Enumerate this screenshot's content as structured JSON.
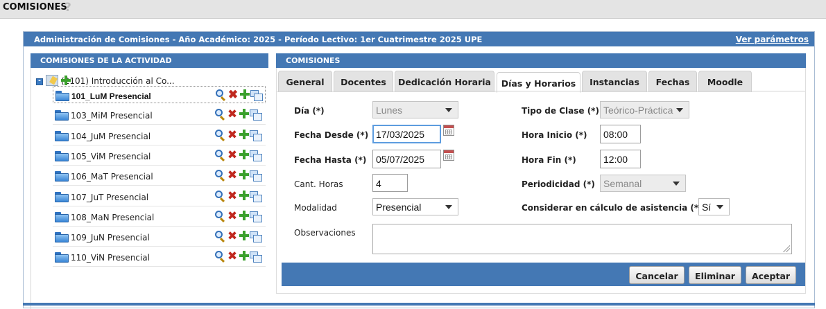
{
  "page": {
    "title": "COMISIONES",
    "help_glyph": "?"
  },
  "header": {
    "title": "Administración de Comisiones - Año Académico: 2025 - Período Lectivo: 1er Cuatrimestre 2025 UPE",
    "link": "Ver parámetros"
  },
  "left": {
    "heading": "COMISIONES DE LA ACTIVIDAD",
    "root": "(2101) Introducción al Co...",
    "items": [
      {
        "label": "101_LuM Presencial",
        "selected": true
      },
      {
        "label": "103_MiM Presencial"
      },
      {
        "label": "104_JuM Presencial"
      },
      {
        "label": "105_ViM Presencial"
      },
      {
        "label": "106_MaT Presencial"
      },
      {
        "label": "107_JuT Presencial"
      },
      {
        "label": "108_MaN Presencial"
      },
      {
        "label": "109_JuN Presencial"
      },
      {
        "label": "110_ViN Presencial"
      }
    ]
  },
  "right": {
    "heading": "COMISIONES",
    "tabs": [
      "General",
      "Docentes",
      "Dedicación Horaria",
      "Días y Horarios",
      "Instancias",
      "Fechas",
      "Moodle"
    ],
    "active_tab": "Días y Horarios"
  },
  "form": {
    "dia_label": "Día (*)",
    "dia_value": "Lunes",
    "fecha_desde_label": "Fecha Desde (*)",
    "fecha_desde_value": "17/03/2025",
    "fecha_hasta_label": "Fecha Hasta (*)",
    "fecha_hasta_value": "05/07/2025",
    "cant_horas_label": "Cant. Horas",
    "cant_horas_value": "4",
    "modalidad_label": "Modalidad",
    "modalidad_value": "Presencial",
    "observaciones_label": "Observaciones",
    "tipo_clase_label": "Tipo de Clase (*)",
    "tipo_clase_value": "Teórico-Práctica",
    "hora_inicio_label": "Hora Inicio (*)",
    "hora_inicio_value": "08:00",
    "hora_fin_label": "Hora Fin (*)",
    "hora_fin_value": "12:00",
    "periodicidad_label": "Periodicidad (*)",
    "periodicidad_value": "Semanal",
    "asistencia_label": "Considerar en cálculo de asistencia (*)",
    "asistencia_value": "Sí"
  },
  "buttons": {
    "cancel": "Cancelar",
    "delete": "Eliminar",
    "accept": "Aceptar"
  },
  "colors": {
    "header_blue": "#4478b4",
    "delete_red": "#c0281e",
    "add_green": "#3aa02c"
  }
}
